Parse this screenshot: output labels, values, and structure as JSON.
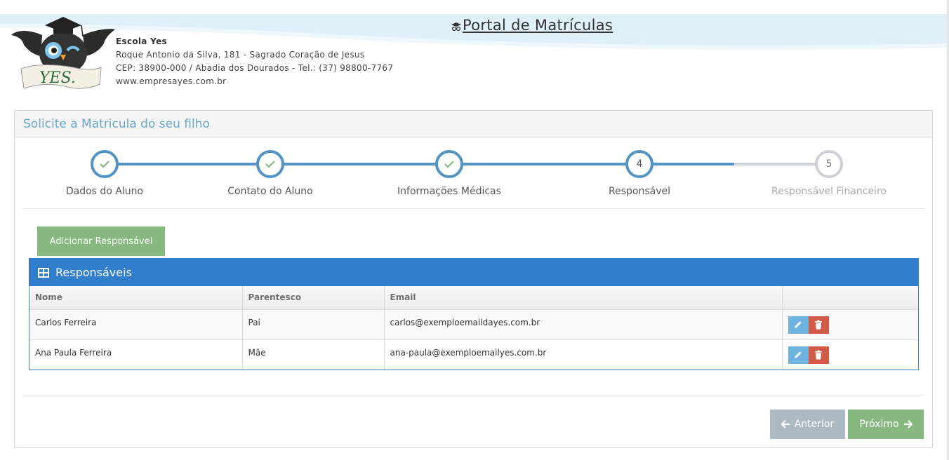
{
  "header": {
    "portal_title": "Portal de Matrículas",
    "school_name": "Escola Yes",
    "address_line": "Roque Antonio da Silva, 181 - Sagrado Coração de Jesus",
    "cep_line": "CEP: 38900-000 / Abadia dos Dourados - Tel.: (37) 98800-7767",
    "website": "www.empresayes.com.br",
    "logo_text": "YES."
  },
  "panel": {
    "title": "Solicite a Matricula do seu filho"
  },
  "wizard": {
    "steps": [
      {
        "label": "Dados do Aluno",
        "number": "1",
        "state": "complete"
      },
      {
        "label": "Contato do Aluno",
        "number": "2",
        "state": "complete"
      },
      {
        "label": "Informações Médicas",
        "number": "3",
        "state": "complete"
      },
      {
        "label": "Responsável",
        "number": "4",
        "state": "active"
      },
      {
        "label": "Responsável Financeiro",
        "number": "5",
        "state": "pending"
      }
    ]
  },
  "actions": {
    "add_label": "Adicionar Responsável",
    "prev_label": "Anterior",
    "next_label": "Próximo"
  },
  "table": {
    "title": "Responsáveis",
    "columns": [
      "Nome",
      "Parentesco",
      "Email",
      ""
    ],
    "rows": [
      {
        "nome": "Carlos Ferreira",
        "parentesco": "Pai",
        "email": "carlos@exemploemaildayes.com.br"
      },
      {
        "nome": "Ana Paula Ferreira",
        "parentesco": "Mãe",
        "email": "ana-paula@exemploemailyes.com.br"
      }
    ]
  },
  "colors": {
    "primary_blue": "#307ecc",
    "step_blue": "#5293c4",
    "success_green": "#87b87f",
    "edit_blue": "#6fb3e0",
    "delete_red": "#d15b47",
    "prev_gray": "#abbac3"
  },
  "icons": [
    "graduation-icon",
    "check-icon",
    "table-icon",
    "pencil-icon",
    "trash-icon",
    "arrow-left-icon",
    "arrow-right-icon"
  ]
}
